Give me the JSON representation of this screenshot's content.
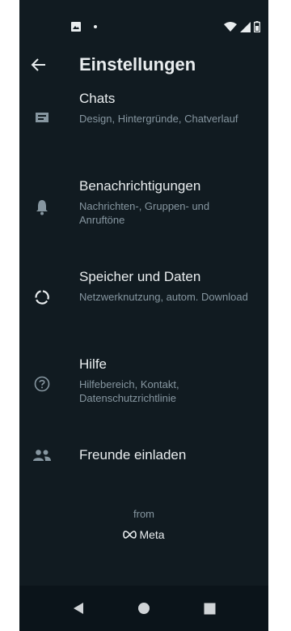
{
  "header": {
    "title": "Einstellungen"
  },
  "items": [
    {
      "title": "Chats",
      "subtitle": "Design, Hintergründe, Chatverlauf",
      "icon": "chat-icon"
    },
    {
      "title": "Benachrichtigungen",
      "subtitle": "Nachrichten-, Gruppen- und Anruftöne",
      "icon": "bell-icon"
    },
    {
      "title": "Speicher und Daten",
      "subtitle": "Netzwerknutzung, autom. Download",
      "icon": "data-usage-icon"
    },
    {
      "title": "Hilfe",
      "subtitle": "Hilfebereich, Kontakt, Datenschutzrichtlinie",
      "icon": "help-icon"
    },
    {
      "title": "Freunde einladen",
      "icon": "people-icon"
    }
  ],
  "footer": {
    "from": "from",
    "brand": "Meta"
  },
  "colors": {
    "background": "#111b21",
    "text_primary": "#e9edef",
    "text_secondary": "#8696a0",
    "icon": "#8696a0"
  }
}
